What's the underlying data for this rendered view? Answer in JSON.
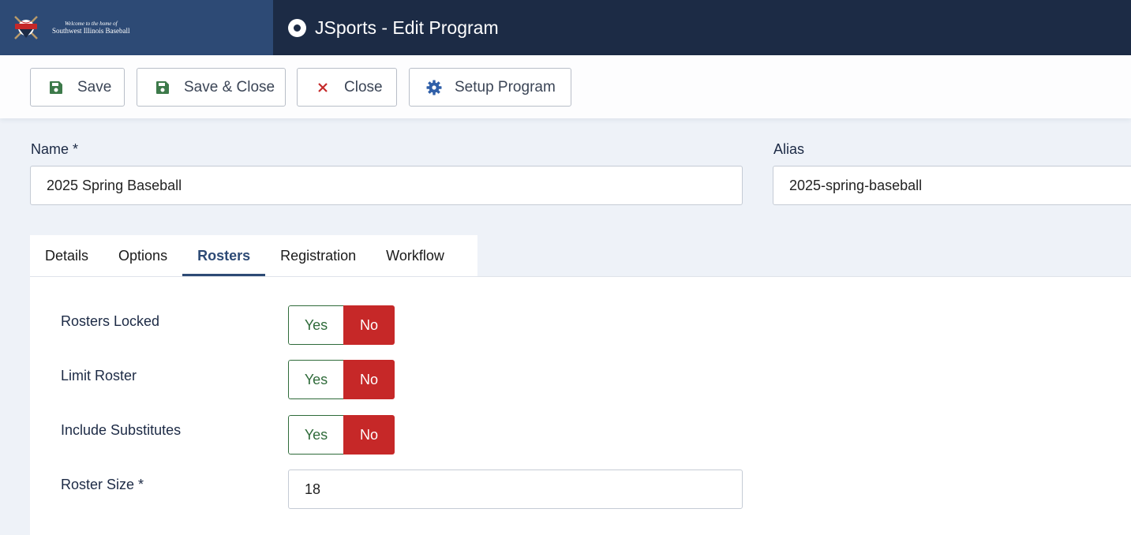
{
  "header": {
    "brand_welcome": "Welcome to the home of",
    "brand_name": "Southwest Illinois Baseball",
    "title": "JSports - Edit Program"
  },
  "toolbar": {
    "save_label": "Save",
    "save_close_label": "Save & Close",
    "close_label": "Close",
    "setup_label": "Setup Program"
  },
  "form": {
    "name_label": "Name *",
    "name_value": "2025 Spring Baseball",
    "alias_label": "Alias",
    "alias_value": "2025-spring-baseball"
  },
  "tabs": [
    {
      "label": "Details"
    },
    {
      "label": "Options"
    },
    {
      "label": "Rosters"
    },
    {
      "label": "Registration"
    },
    {
      "label": "Workflow"
    }
  ],
  "rosters": {
    "rows": [
      {
        "label": "Rosters Locked",
        "yes": "Yes",
        "no": "No"
      },
      {
        "label": "Limit Roster",
        "yes": "Yes",
        "no": "No"
      },
      {
        "label": "Include Substitutes",
        "yes": "Yes",
        "no": "No"
      }
    ],
    "roster_size_label": "Roster Size *",
    "roster_size_value": "18"
  },
  "colors": {
    "header_bg": "#1c2b45",
    "brand_bg": "#2d4a75",
    "active_tab": "#2d4a75",
    "no_active": "#c62828",
    "yes_border": "#2f6b3a",
    "save_icon": "#3d7a4a",
    "close_icon": "#c52a2a",
    "gear_icon": "#2f5fa8"
  }
}
